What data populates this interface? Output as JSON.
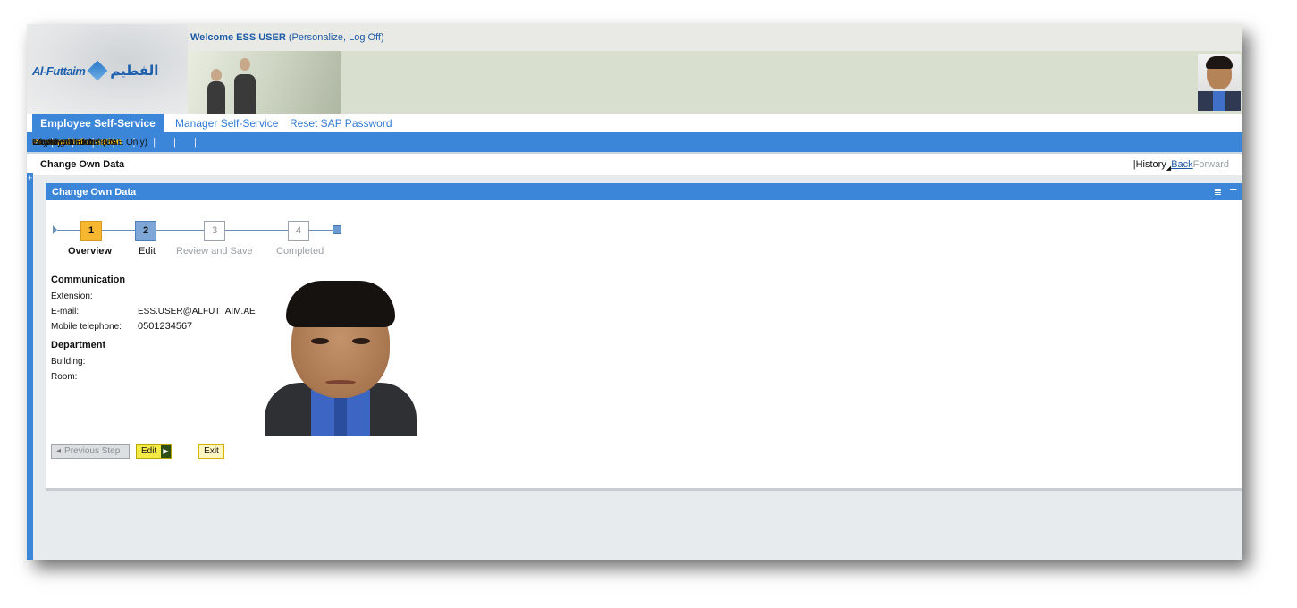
{
  "header": {
    "welcome_prefix": "Welcome ESS USER",
    "welcome_links": "(Personalize, Log Off)",
    "logo_en": "Al-Futtaim",
    "logo_ar": "الفطيم"
  },
  "tabs": [
    {
      "label": "Employee Self-Service",
      "active": true
    },
    {
      "label": "Manager Self-Service",
      "active": false
    },
    {
      "label": "Reset SAP Password",
      "active": false
    }
  ],
  "subnav": [
    {
      "label": "Overview"
    },
    {
      "label": "Life and Work Events"
    },
    {
      "label": "Employee Search"
    },
    {
      "label": "Working Time"
    },
    {
      "label": "Payment"
    },
    {
      "label": "Personal Information",
      "active": true
    },
    {
      "label": "Career and Job"
    },
    {
      "label": "Travel and Expenses"
    },
    {
      "label": "Employee Forms (UAE Only)"
    }
  ],
  "page": {
    "title": "Change Own Data",
    "history": "History",
    "back": "Back",
    "forward": "Forward"
  },
  "panel": {
    "title": "Change Own Data",
    "menu_icon": "list-menu-icon",
    "minimize_icon": "minimize-icon"
  },
  "roadmap": {
    "steps": [
      {
        "number": "1",
        "label": "Overview",
        "state": "current"
      },
      {
        "number": "2",
        "label": "Edit",
        "state": "next"
      },
      {
        "number": "3",
        "label": "Review and Save",
        "state": "disabled"
      },
      {
        "number": "4",
        "label": "Completed",
        "state": "disabled"
      }
    ]
  },
  "communication": {
    "heading": "Communication",
    "extension_label": "Extension:",
    "extension_value": "",
    "email_label": "E-mail:",
    "email_value": "ESS.USER@ALFUTTAIM.AE",
    "mobile_label": "Mobile telephone:",
    "mobile_value": "0501234567"
  },
  "department": {
    "heading": "Department",
    "building_label": "Building:",
    "building_value": "",
    "room_label": "Room:",
    "room_value": ""
  },
  "buttons": {
    "previous": "Previous Step",
    "edit": "Edit",
    "exit": "Exit"
  },
  "colors": {
    "brand_blue": "#3b86d9",
    "active_nav": "#ffc400",
    "step_current": "#f7b731",
    "step_next": "#7ea7d8"
  }
}
